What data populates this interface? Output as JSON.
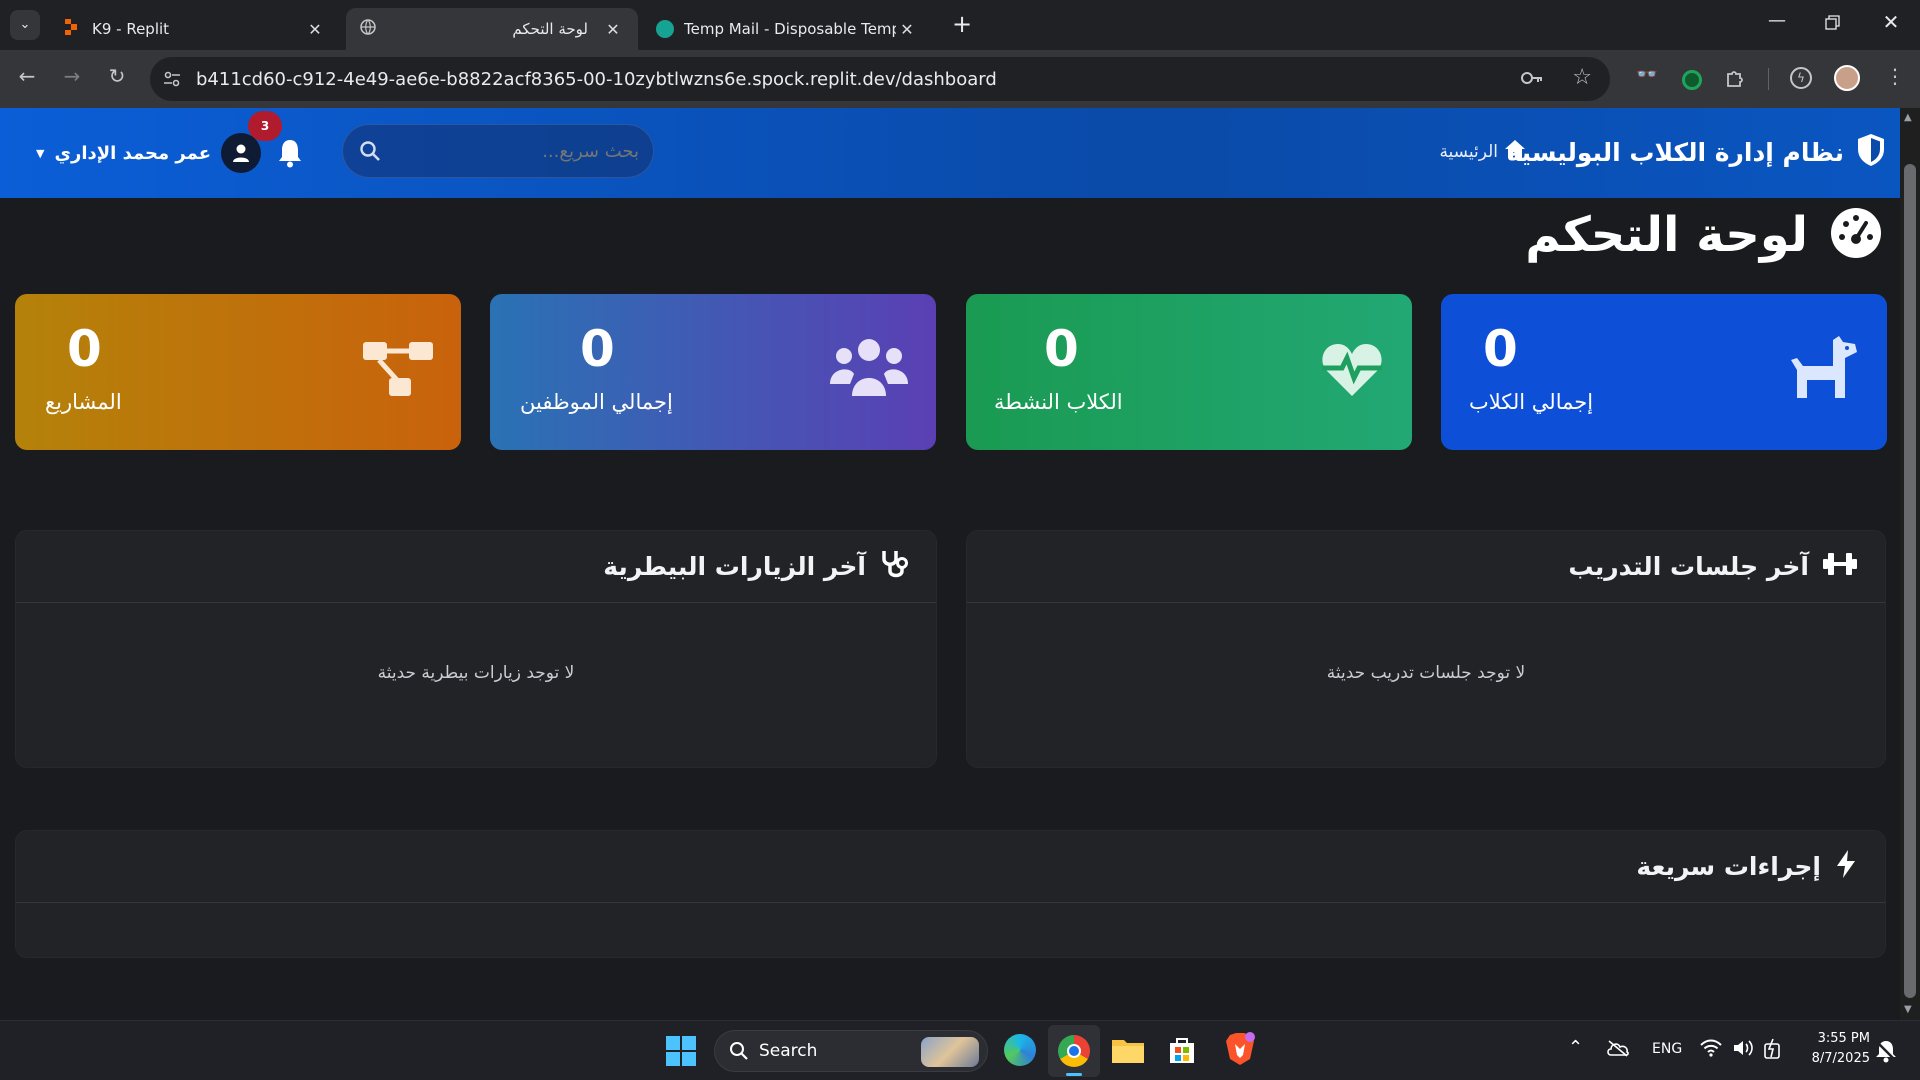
{
  "browser": {
    "tabs": [
      {
        "title": "K9 - Replit",
        "active": false
      },
      {
        "title": "لوحة التحكم",
        "active": true
      },
      {
        "title": "Temp Mail - Disposable Tempor",
        "active": false
      }
    ],
    "url": "b411cd60-c912-4e49-ae6e-b8822acf8365-00-10zybtlwzns6e.spock.replit.dev/dashboard"
  },
  "header": {
    "brand": "نظام إدارة الكلاب البوليسية",
    "home_link": "الرئيسية",
    "search_placeholder": "بحث سريع...",
    "notification_count": "3",
    "user_name": "عمر محمد الإداري"
  },
  "page": {
    "title": "لوحة التحكم"
  },
  "stats": [
    {
      "value": "0",
      "label": "إجمالي الكلاب",
      "icon": "dog-icon",
      "color": "#0d4fd6"
    },
    {
      "value": "0",
      "label": "الكلاب النشطة",
      "icon": "heartbeat-icon",
      "color": "#1e9e5f"
    },
    {
      "value": "0",
      "label": "إجمالي الموظفين",
      "icon": "users-icon",
      "color": "#3e4fb0"
    },
    {
      "value": "0",
      "label": "المشاريع",
      "icon": "project-diagram-icon",
      "color": "#c46a10"
    }
  ],
  "panels": {
    "training": {
      "title": "آخر جلسات التدريب",
      "empty": "لا توجد جلسات تدريب حديثة"
    },
    "vet": {
      "title": "آخر الزيارات البيطرية",
      "empty": "لا توجد زيارات بيطرية حديثة"
    },
    "quick": {
      "title": "إجراءات سريعة"
    }
  },
  "taskbar": {
    "search_label": "Search",
    "lang": "ENG",
    "time": "3:55 PM",
    "date": "8/7/2025"
  }
}
